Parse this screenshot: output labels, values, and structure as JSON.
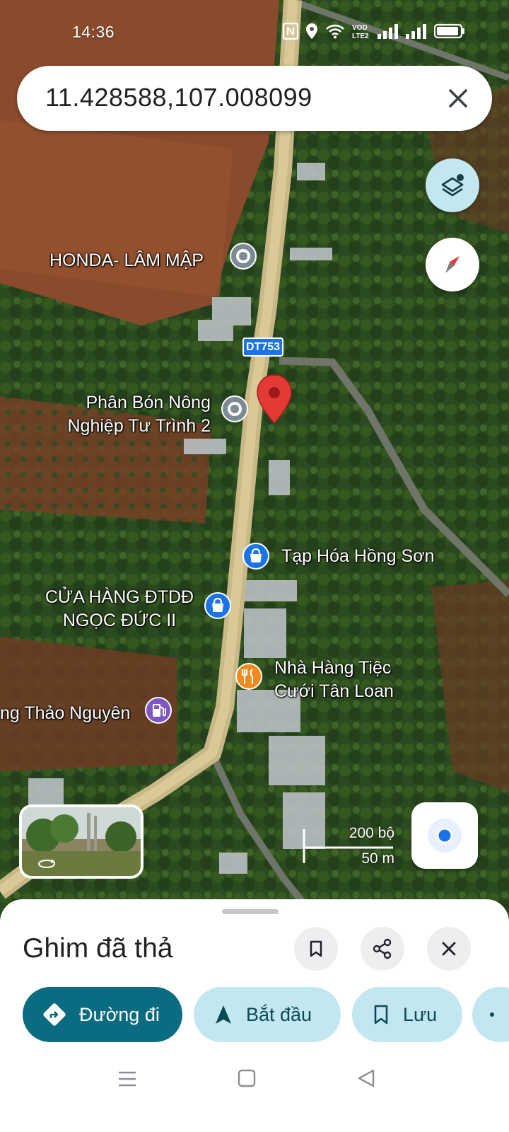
{
  "status_bar": {
    "time": "14:36"
  },
  "search": {
    "value": "11.428588,107.008099"
  },
  "map": {
    "road_shield": "DT753",
    "scale": {
      "imperial": "200 bộ",
      "metric": "50 m"
    },
    "places": [
      {
        "name": "HONDA- LÂM MẬP",
        "icon": "place-marker-icon"
      },
      {
        "name": "Phân Bón Nông Nghiệp Tư Trình 2",
        "line1": "Phân Bón Nông",
        "line2": "Nghiệp Tư Trình 2",
        "icon": "place-marker-icon"
      },
      {
        "name": "Tạp Hóa Hồng Sơn",
        "icon": "shopping-bag-icon"
      },
      {
        "name": "CỬA HÀNG ĐTDĐ NGỌC ĐỨC II",
        "line1": "CỬA HÀNG ĐTDĐ",
        "line2": "NGỌC ĐỨC II",
        "icon": "shopping-bag-icon"
      },
      {
        "name": "Nhà Hàng Tiệc Cưới Tân Loan",
        "line1": "Nhà Hàng Tiệc",
        "line2": "Cưới Tân Loan",
        "icon": "restaurant-icon"
      },
      {
        "name": "ng Thảo Nguyên",
        "icon": "gas-station-icon"
      }
    ]
  },
  "bottom_sheet": {
    "title": "Ghim đã thả",
    "actions": {
      "directions": "Đường đi",
      "start": "Bắt đầu",
      "save": "Lưu"
    }
  },
  "colors": {
    "accent": "#0b6b80",
    "chip": "#c2e7f0",
    "pin": "#e53935"
  }
}
